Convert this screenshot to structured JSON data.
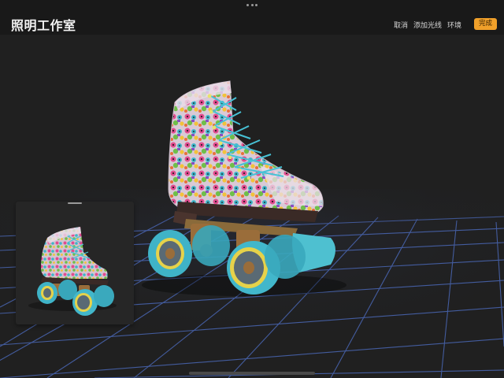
{
  "app": {
    "title": "照明工作室"
  },
  "toolbar": {
    "cancel_label": "取消",
    "add_light_label": "添加光线",
    "environment_label": "环境",
    "done_label": "完成"
  },
  "colors": {
    "accent": "#f0a02a",
    "grid_line": "#4a67b5",
    "background": "#202020"
  },
  "scene": {
    "object": "roller-skate"
  }
}
